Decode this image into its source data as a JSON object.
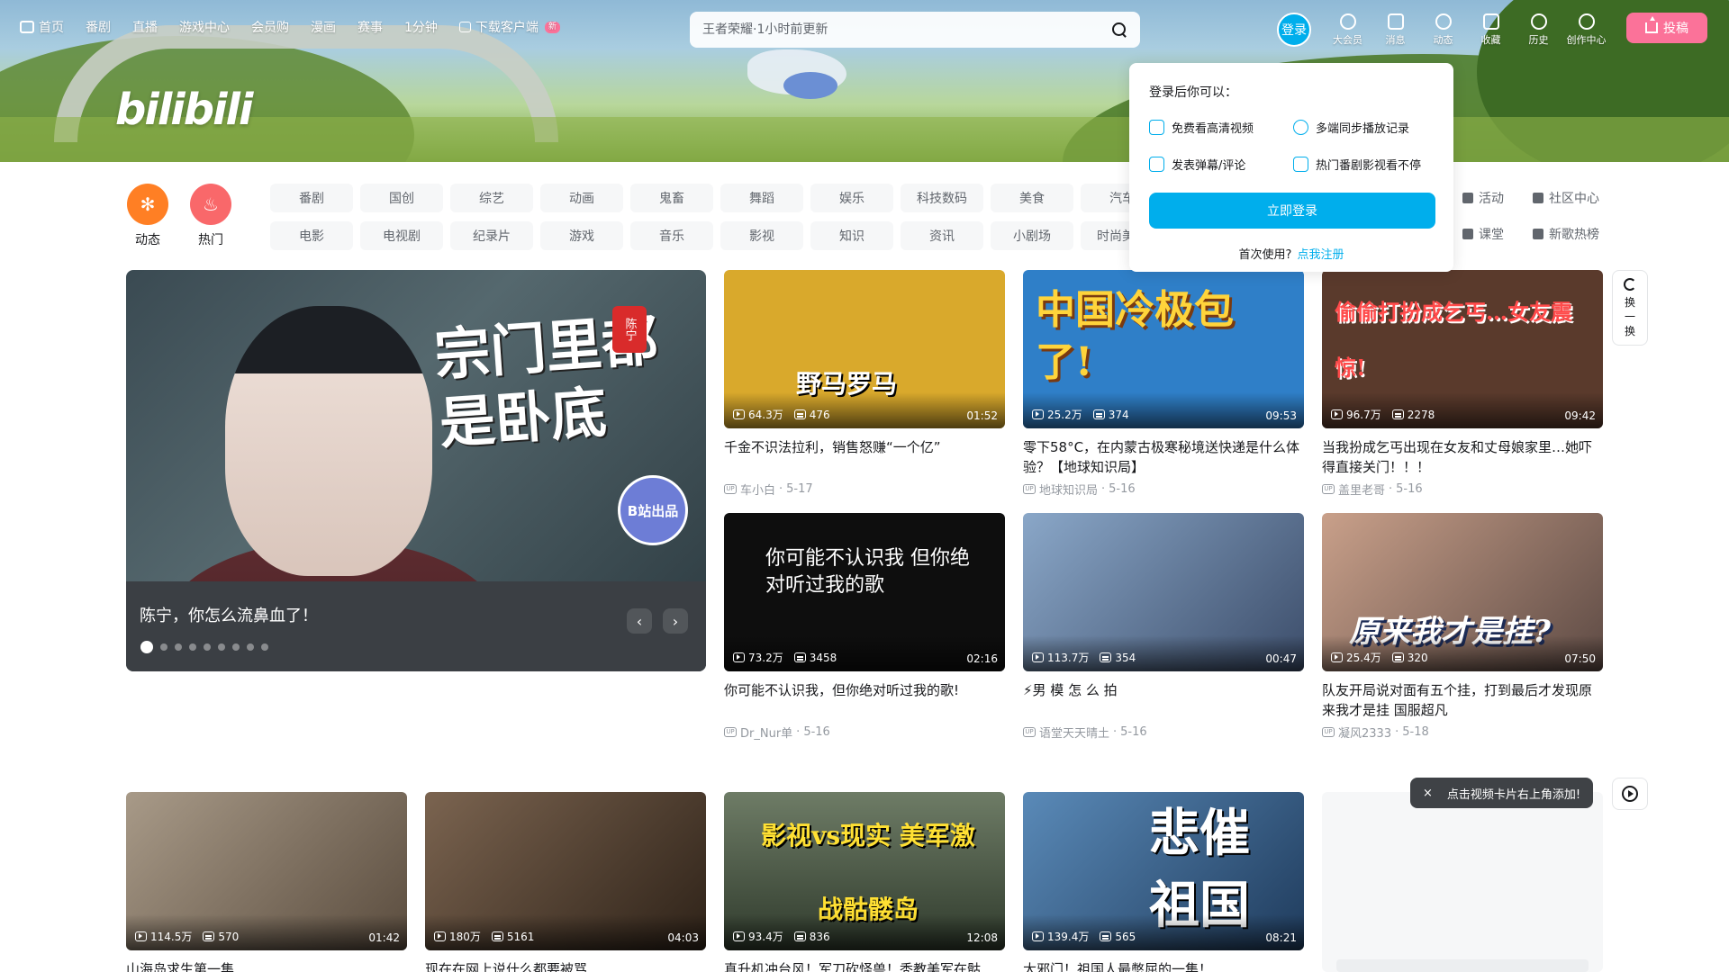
{
  "topnav": {
    "items": [
      "首页",
      "番剧",
      "直播",
      "游戏中心",
      "会员购",
      "漫画",
      "赛事",
      "1分钟",
      "下载客户端"
    ],
    "new_badge": "新"
  },
  "logo": "bilibili",
  "search": {
    "placeholder": "王者荣耀·1小时前更新"
  },
  "right_nav": {
    "login": "登录",
    "items": [
      "大会员",
      "消息",
      "动态",
      "收藏",
      "历史",
      "创作中心"
    ],
    "upload": "投稿"
  },
  "channels": {
    "big": [
      {
        "label": "动态",
        "color": "#ff7f24"
      },
      {
        "label": "热门",
        "color": "#f9686a"
      }
    ],
    "grid": [
      "番剧",
      "国创",
      "综艺",
      "动画",
      "鬼畜",
      "舞蹈",
      "娱乐",
      "科技数码",
      "美食",
      "汽车",
      "电影",
      "电视剧",
      "纪录片",
      "游戏",
      "音乐",
      "影视",
      "知识",
      "资讯",
      "小剧场",
      "时尚美妆"
    ],
    "side": [
      "活动",
      "社区中心",
      "课堂",
      "新歌热榜"
    ]
  },
  "carousel": {
    "caption": "陈宁，你怎么流鼻血了！",
    "art_text": "宗门里都是卧底",
    "seal": "陈宁",
    "badge": "B站出品",
    "prev": "‹",
    "next": "›"
  },
  "videos": [
    {
      "title": "千金不识法拉利，销售怒赚“一个亿”",
      "views": "64.3万",
      "danmu": "476",
      "duration": "01:52",
      "up": "车小白",
      "date": "5-17",
      "art": "野马罗马",
      "bg": "#d9a92c",
      "fg": "#ffffff"
    },
    {
      "title": "零下58°C，在内蒙古极寒秘境送快递是什么体验？【地球知识局】",
      "views": "25.2万",
      "danmu": "374",
      "duration": "09:53",
      "up": "地球知识局",
      "date": "5-16",
      "art": "中国冷极包了!",
      "bg": "#2f7fc8",
      "fg": "#ffd43b"
    },
    {
      "title": "当我扮成乞丐出现在女友和丈母娘家里…她吓得直接关门！！！",
      "views": "96.7万",
      "danmu": "2278",
      "duration": "09:42",
      "up": "盖里老哥",
      "date": "5-16",
      "art": "偷偷打扮成乞丐…女友震惊!",
      "bg": "#5a3a2c",
      "fg": "#ff3b3b"
    },
    {
      "title": "你可能不认识我，但你绝对听过我的歌!",
      "views": "73.2万",
      "danmu": "3458",
      "duration": "02:16",
      "up": "Dr_Nur单",
      "date": "5-16",
      "art": "你可能不认识我 但你绝对听过我的歌",
      "bg": "#0e0e0e",
      "fg": "#ffffff"
    },
    {
      "title": "⚡男 模 怎 么 拍",
      "views": "113.7万",
      "danmu": "354",
      "duration": "00:47",
      "up": "语堂天天晴土",
      "date": "5-16",
      "art": "",
      "bg": "#6b8bb5",
      "fg": "#ffffff"
    },
    {
      "title": "队友开局说对面有五个挂，打到最后才发现原来我才是挂 国服超凡",
      "views": "25.4万",
      "danmu": "320",
      "duration": "07:50",
      "up": "凝风2333",
      "date": "5-18",
      "art": "原来我才是挂?",
      "bg": "#8a6a5a",
      "fg": "#ffffff"
    },
    {
      "title": "山海岛求生第一集",
      "views": "114.5万",
      "danmu": "570",
      "duration": "01:42",
      "up": "",
      "date": "",
      "art": "",
      "bg": "#8c7b68",
      "fg": "#ffffff"
    },
    {
      "title": "现在在网上说什么都要被骂",
      "views": "180万",
      "danmu": "5161",
      "duration": "04:03",
      "up": "",
      "date": "",
      "art": "",
      "bg": "#5b4636",
      "fg": "#ffffff"
    },
    {
      "title": "真升机冲台风！军刀砍怪兽！秃教美军在骷",
      "views": "93.4万",
      "danmu": "836",
      "duration": "12:08",
      "up": "",
      "date": "",
      "art": "影视vs现实 美军激战骷髅岛",
      "bg": "#4a5a44",
      "fg": "#ffe033"
    },
    {
      "title": "大邪门！祖国人最憋屈的一集！",
      "views": "139.4万",
      "danmu": "565",
      "duration": "08:21",
      "up": "",
      "date": "",
      "art": "悲催祖国人",
      "bg": "#3e6a9a",
      "fg": "#ffffff"
    }
  ],
  "login_popup": {
    "title": "登录后你可以：",
    "features": [
      "免费看高清视频",
      "多端同步播放记录",
      "发表弹幕/评论",
      "热门番剧影视看不停"
    ],
    "button": "立即登录",
    "first_use": "首次使用?",
    "register": "点我注册"
  },
  "refresh": {
    "chars": [
      "换",
      "一",
      "换"
    ]
  },
  "tip": {
    "close": "×",
    "text": "点击视频卡片右上角添加!"
  },
  "colors": {
    "accent": "#00aeec",
    "pink": "#fb7299"
  }
}
